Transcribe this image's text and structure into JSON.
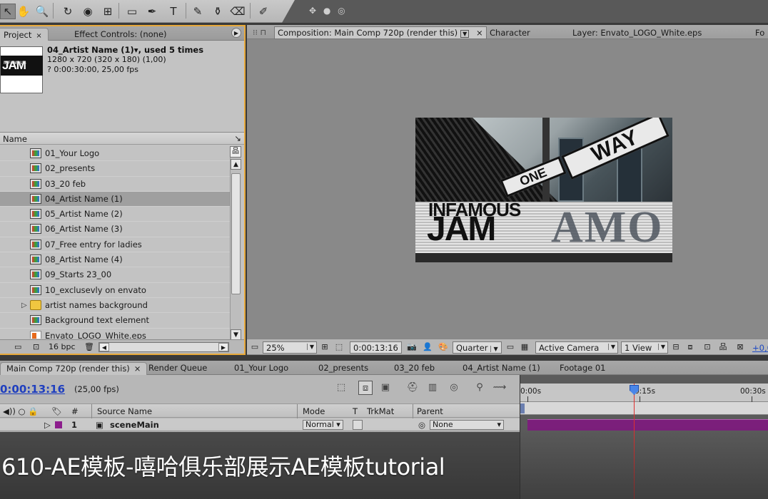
{
  "toolbar": {
    "tools": [
      "selection-tool",
      "hand-tool",
      "zoom-tool",
      "rotate-tool",
      "orbit-camera-tool",
      "track-xy-tool",
      "rectangle-tool",
      "pen-tool",
      "text-tool",
      "brush-tool",
      "clone-stamp-tool",
      "eraser-tool",
      "puppet-pin-tool"
    ],
    "glyphs": [
      "↖",
      "✋",
      "🔍",
      "↻",
      "◉",
      "⊞",
      "▭",
      "✒",
      "T",
      "✎",
      "⚱",
      "⌫",
      "✐"
    ],
    "anchor_glyphs": "✥ ● ◎"
  },
  "project_panel": {
    "tab_project": "Project",
    "tab_close": "×",
    "tab_effect_controls": "Effect Controls: (none)",
    "thumb_top_text": "INFAMOUS",
    "thumb_main_text": "JAM",
    "info_title": "04_Artist Name (1)▾, used 5 times",
    "info_dims": "1280 x 720  (320 x 180) (1,00)",
    "info_duration": "? 0:00:30:00, 25,00 fps",
    "column_name": "Name",
    "column_end_glyph": "↘",
    "items": [
      {
        "label": "01_Your Logo",
        "type": "comp",
        "selected": false
      },
      {
        "label": "02_presents",
        "type": "comp",
        "selected": false
      },
      {
        "label": "03_20 feb",
        "type": "comp",
        "selected": false
      },
      {
        "label": "04_Artist Name (1)",
        "type": "comp",
        "selected": true
      },
      {
        "label": "05_Artist Name (2)",
        "type": "comp",
        "selected": false
      },
      {
        "label": "06_Artist Name (3)",
        "type": "comp",
        "selected": false
      },
      {
        "label": "07_Free entry for ladies",
        "type": "comp",
        "selected": false
      },
      {
        "label": "08_Artist Name (4)",
        "type": "comp",
        "selected": false
      },
      {
        "label": "09_Starts 23_00",
        "type": "comp",
        "selected": false
      },
      {
        "label": "10_exclusevly on envato",
        "type": "comp",
        "selected": false
      },
      {
        "label": "artist names background",
        "type": "folder",
        "selected": false
      },
      {
        "label": "Background text element",
        "type": "comp",
        "selected": false
      },
      {
        "label": "Envato_LOGO_White.eps",
        "type": "eps",
        "selected": false
      }
    ],
    "bit_depth": "16 bpc"
  },
  "comp_panel": {
    "tab_composition": "Composition: Main Comp 720p (render this)",
    "tab_character": "Character",
    "tab_layer": "Layer: Envato_LOGO_White.eps",
    "tab_fo": "Fo",
    "canvas_sign_text": "WAY",
    "canvas_sign2_text": "ONE",
    "canvas_logo_top": "INFAMOUS",
    "canvas_logo_main": "JAM",
    "canvas_logo_ghost": "AMO",
    "zoom": "25%",
    "timecode": "0:00:13:16",
    "resolution": "Quarter",
    "camera": "Active Camera",
    "views": "1 View",
    "exposure": "+0,0"
  },
  "timeline": {
    "tabs": [
      {
        "label": "Main Comp 720p (render this)",
        "active": true
      },
      {
        "label": "Render Queue",
        "active": false
      },
      {
        "label": "01_Your Logo",
        "active": false
      },
      {
        "label": "02_presents",
        "active": false
      },
      {
        "label": "03_20 feb",
        "active": false
      },
      {
        "label": "04_Artist Name (1)",
        "active": false
      },
      {
        "label": "Footage 01",
        "active": false
      }
    ],
    "close_glyph": "×",
    "current_time": "0:00:13:16",
    "fps": "(25,00 fps)",
    "columns": {
      "hash": "#",
      "source_name": "Source Name",
      "mode": "Mode",
      "t": "T",
      "trkmat": "TrkMat",
      "parent": "Parent"
    },
    "layer": {
      "index": "1",
      "name": "sceneMain",
      "mode": "Normal",
      "parent": "None"
    },
    "ruler_labels": {
      "start": "0:00s",
      "mid": "0:15s",
      "end": "00:30s"
    },
    "current_time_fraction": 0.453
  },
  "caption": "610-AE模板-嘻哈俱乐部展示AE模板tutorial"
}
